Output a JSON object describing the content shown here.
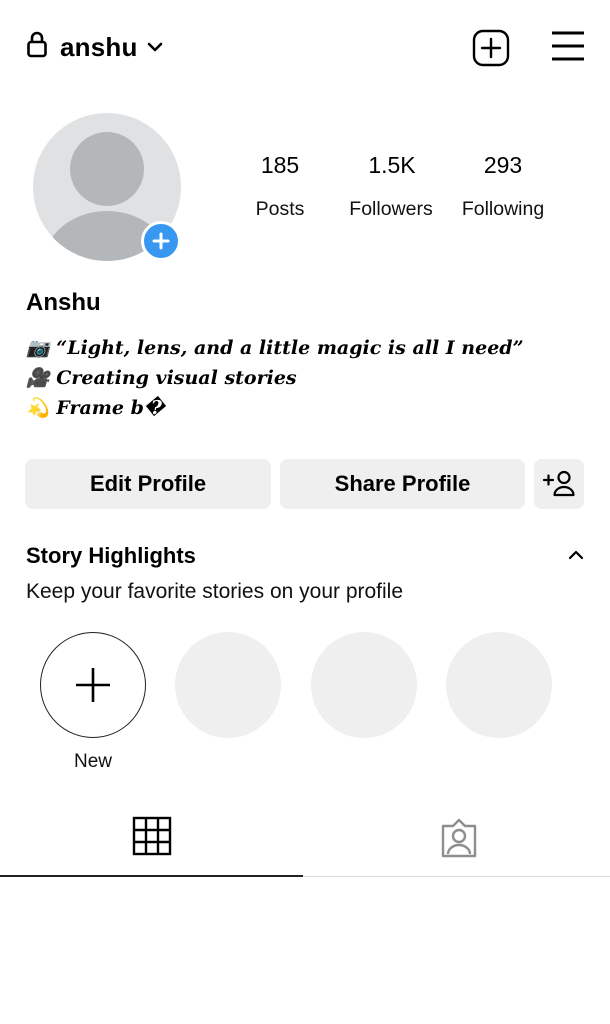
{
  "header": {
    "username": "anshu",
    "icons": {
      "lock": "lock-icon",
      "chevron": "chevron-down-icon",
      "create": "plus-square-icon",
      "menu": "hamburger-menu-icon"
    }
  },
  "profile": {
    "avatar_icon": "default-avatar-icon",
    "add_story_icon": "plus-circle-icon",
    "stats": {
      "posts": {
        "value": "185",
        "label": "Posts"
      },
      "followers": {
        "value": "1.5K",
        "label": "Followers"
      },
      "following": {
        "value": "293",
        "label": "Following"
      }
    },
    "full_name": "Anshu",
    "bio": [
      {
        "emoji": "📷",
        "text": "“Light, lens, and a little magic is all I need”"
      },
      {
        "emoji": "🎥",
        "text": "Creating visual stories"
      },
      {
        "emoji": "💫",
        "text": "Frame b�"
      }
    ]
  },
  "actions": {
    "edit_label": "Edit Profile",
    "share_label": "Share Profile",
    "suggest_icon": "add-person-icon"
  },
  "highlights": {
    "title": "Story Highlights",
    "subtitle": "Keep your favorite stories on your profile",
    "new_label": "New",
    "collapse_icon": "chevron-up-icon"
  },
  "tabs": {
    "grid_icon": "grid-icon",
    "tagged_icon": "tagged-person-icon"
  },
  "colors": {
    "accent": "#3897f0",
    "button_bg": "#efefef",
    "placeholder": "#dfe1e3"
  }
}
